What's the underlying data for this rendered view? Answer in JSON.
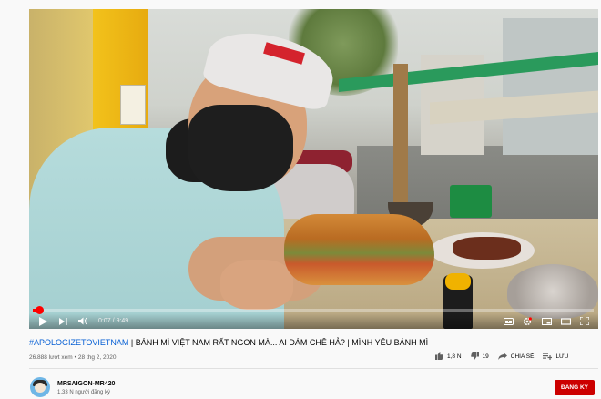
{
  "player": {
    "current_time": "0:07",
    "time_separator": "/",
    "duration": "9:49",
    "progress_fraction": 0.012,
    "accent_color": "#ff0000",
    "icons": [
      "play-icon",
      "next-icon",
      "volume-icon",
      "subtitles-icon",
      "settings-icon",
      "miniplayer-icon",
      "theater-icon",
      "fullscreen-icon"
    ]
  },
  "video": {
    "hashtag": "#APOLOGIZETOVIETNAM",
    "title_rest": " | BÁNH MÌ VIỆT NAM RẤT NGON MÀ... AI DÁM CHÊ HẢ? | MÌNH YÊU BÁNH MÌ",
    "views": "26.888 lượt xem",
    "date_separator": "•",
    "date": "28 thg 2, 2020"
  },
  "actions": {
    "like_count": "1,8 N",
    "dislike_count": "19",
    "share_label": "CHIA SẺ",
    "save_label": "LƯU"
  },
  "channel": {
    "name": "MRSAIGON-MR420",
    "subscribers": "1,33 N người đăng ký",
    "subscribe_label": "ĐĂNG KÝ",
    "subscribe_color": "#cc0000"
  }
}
